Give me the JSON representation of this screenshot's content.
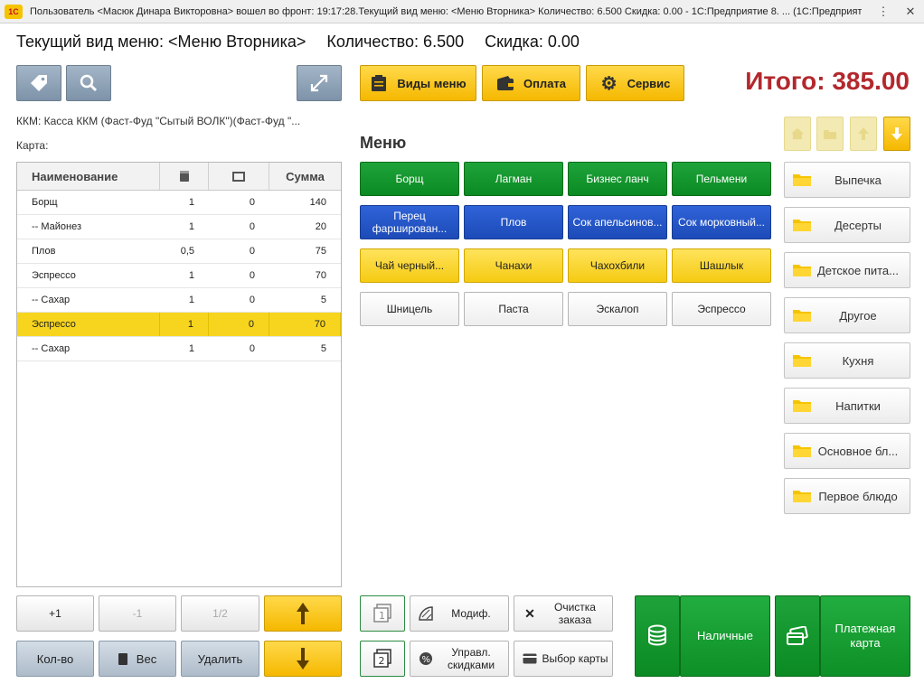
{
  "window": {
    "title": "Пользователь <Масюк Динара Викторовна> вошел во фронт: 19:17:28.Текущий вид меню: <Меню Вторника>     Количество: 6.500     Скидка: 0.00 - 1С:Предприятие 8. ...  (1С:Предприятие)",
    "logo": "1С"
  },
  "header": {
    "menu_view": "Текущий вид меню: <Меню Вторника>",
    "quantity": "Количество: 6.500",
    "discount": "Скидка: 0.00"
  },
  "total": "Итого: 385.00",
  "toolbar": {
    "menu_types": "Виды меню",
    "payment": "Оплата",
    "service": "Сервис"
  },
  "info": {
    "kkm": "ККМ: Касса ККМ  (Фаст-Фуд \"Сытый ВОЛК\")(Фаст-Фуд \"...",
    "card": "Карта:"
  },
  "order_table": {
    "headers": {
      "name": "Наименование",
      "sum": "Сумма"
    },
    "rows": [
      {
        "name": "Борщ",
        "qty": "1",
        "disc": "0",
        "sum": "140"
      },
      {
        "name": "-- Майонез",
        "qty": "1",
        "disc": "0",
        "sum": "20"
      },
      {
        "name": "Плов",
        "qty": "0,5",
        "disc": "0",
        "sum": "75"
      },
      {
        "name": "Эспрессо",
        "qty": "1",
        "disc": "0",
        "sum": "70"
      },
      {
        "name": "-- Сахар",
        "qty": "1",
        "disc": "0",
        "sum": "5"
      },
      {
        "name": "Эспрессо",
        "qty": "1",
        "disc": "0",
        "sum": "70"
      },
      {
        "name": "-- Сахар",
        "qty": "1",
        "disc": "0",
        "sum": "5"
      }
    ],
    "selected_row": 5
  },
  "bottom_left": {
    "plus_one": "+1",
    "minus_one": "-1",
    "half": "1/2",
    "qty": "Кол-во",
    "weight": "Вес",
    "delete": "Удалить"
  },
  "menu": {
    "title": "Меню",
    "dishes": [
      [
        "Борщ",
        "Лагман",
        "Бизнес ланч",
        "Пельмени"
      ],
      [
        "Перец фарширован...",
        "Плов",
        "Сок апельсинов...",
        "Сок морковный..."
      ],
      [
        "Чай черный...",
        "Чанахи",
        "Чахохбили",
        "Шашлык"
      ],
      [
        "Шницель",
        "Паста",
        "Эскалоп",
        "Эспрессо"
      ]
    ]
  },
  "categories": [
    "Выпечка",
    "Десерты",
    "Детское пита...",
    "Другое",
    "Кухня",
    "Напитки",
    "Основное бл...",
    "Первое блюдо"
  ],
  "actions": {
    "modif": "Модиф.",
    "clear_order": "Очистка заказа",
    "discounts": "Управл. скидками",
    "card_select": "Выбор карты"
  },
  "payment_buttons": {
    "cash": "Наличные",
    "card": "Платежная карта"
  },
  "colors": {
    "total": "#b3282d",
    "accent_yellow": "#f5b800",
    "dish_green": "#0b8a22",
    "dish_blue": "#1d4bb8",
    "selected_row": "#f7d51e"
  }
}
